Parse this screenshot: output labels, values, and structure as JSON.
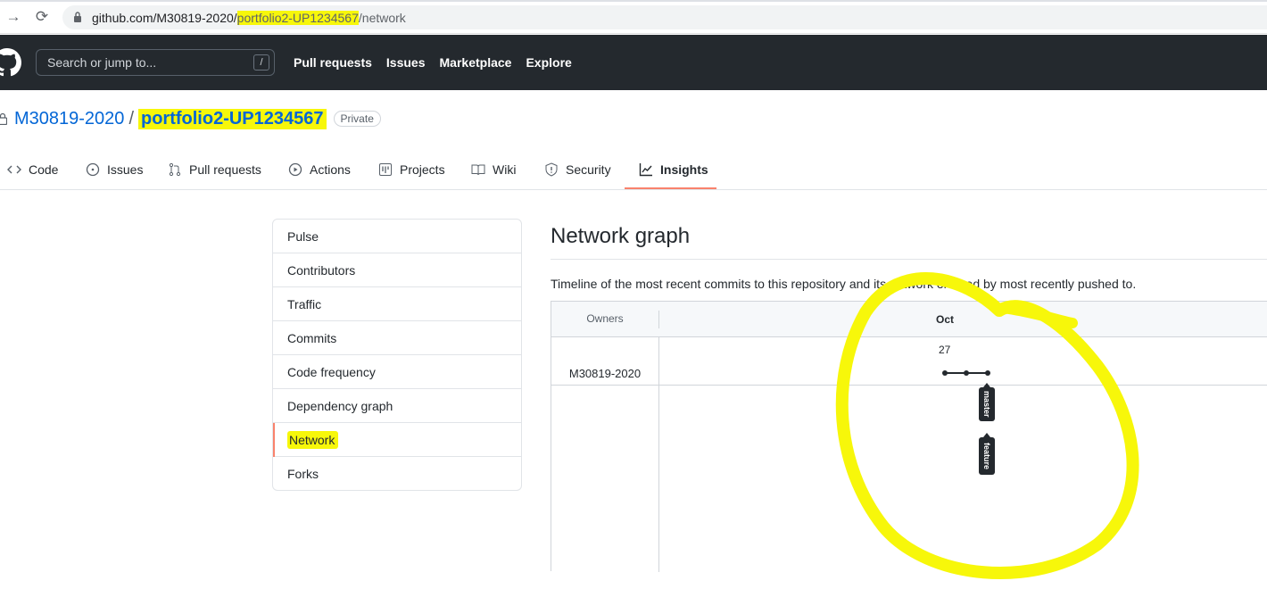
{
  "browser": {
    "url_prefix": "github.com/M30819-2020/",
    "url_highlight": "portfolio2-UP1234567",
    "url_suffix": "/network"
  },
  "header": {
    "search_placeholder": "Search or jump to...",
    "slash_key": "/",
    "nav": [
      "Pull requests",
      "Issues",
      "Marketplace",
      "Explore"
    ]
  },
  "repo": {
    "owner": "M30819-2020",
    "separator": "/",
    "name": "portfolio2-UP1234567",
    "visibility": "Private"
  },
  "tabs": [
    {
      "label": "Code",
      "icon": "code-icon"
    },
    {
      "label": "Issues",
      "icon": "issue-icon"
    },
    {
      "label": "Pull requests",
      "icon": "pull-request-icon"
    },
    {
      "label": "Actions",
      "icon": "play-icon"
    },
    {
      "label": "Projects",
      "icon": "project-icon"
    },
    {
      "label": "Wiki",
      "icon": "book-icon"
    },
    {
      "label": "Security",
      "icon": "shield-icon"
    },
    {
      "label": "Insights",
      "icon": "graph-icon",
      "active": true
    }
  ],
  "sidebar": {
    "items": [
      "Pulse",
      "Contributors",
      "Traffic",
      "Commits",
      "Code frequency",
      "Dependency graph",
      "Network",
      "Forks"
    ],
    "selected": "Network"
  },
  "main": {
    "title": "Network graph",
    "description": "Timeline of the most recent commits to this repository and its network ordered by most recently pushed to."
  },
  "graph": {
    "owners_header": "Owners",
    "month": "Oct",
    "day": "27",
    "owner": "M30819-2020",
    "branches": [
      "master",
      "feature"
    ],
    "commit_count": 3
  },
  "colors": {
    "header_bg": "#24292e",
    "link": "#0366d6",
    "active_accent": "#f9826c",
    "highlighter": "#f7f70a"
  }
}
